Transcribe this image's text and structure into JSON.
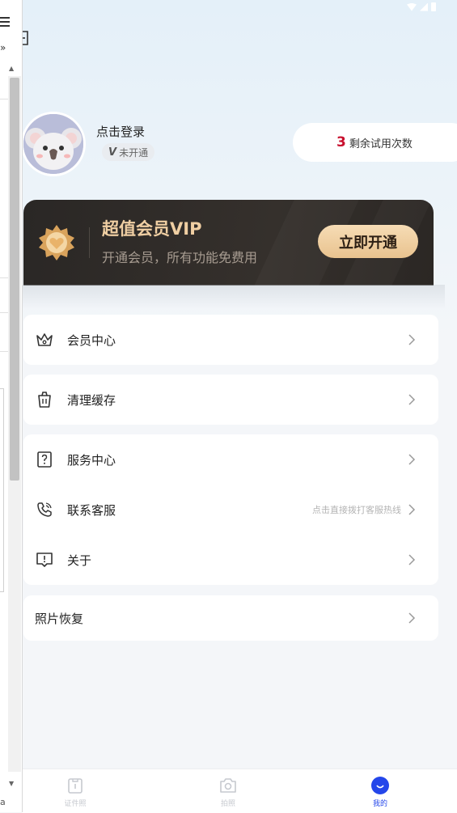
{
  "profile": {
    "login_text": "点击登录",
    "vip_status_mark": "V",
    "vip_status_text": "未开通"
  },
  "trial": {
    "count": "3",
    "label": "剩余试用次数"
  },
  "vip_card": {
    "title": "超值会员VIP",
    "subtitle": "开通会员，所有功能免费用",
    "button_label": "立即开通"
  },
  "menu": {
    "member_center": "会员中心",
    "clear_cache": "清理缓存",
    "service_center": "服务中心",
    "contact_support": "联系客服",
    "contact_support_hint": "点击直接拨打客服热线",
    "about": "关于",
    "photo_recovery": "照片恢复"
  },
  "bottom_nav": {
    "tabs": [
      {
        "label": "证件照",
        "icon": "id-photo-icon",
        "active": false
      },
      {
        "label": "拍照",
        "icon": "camera-icon",
        "active": false
      },
      {
        "label": "我的",
        "icon": "smile-face-icon",
        "active": true
      }
    ]
  },
  "side_panel": {
    "chevron_text": "»",
    "bottom_char": "a"
  },
  "colors": {
    "accent_blue": "#2446ea",
    "trial_red": "#c8102e",
    "vip_gold": "#f0cfa3",
    "vip_dark": "#2a2725"
  }
}
